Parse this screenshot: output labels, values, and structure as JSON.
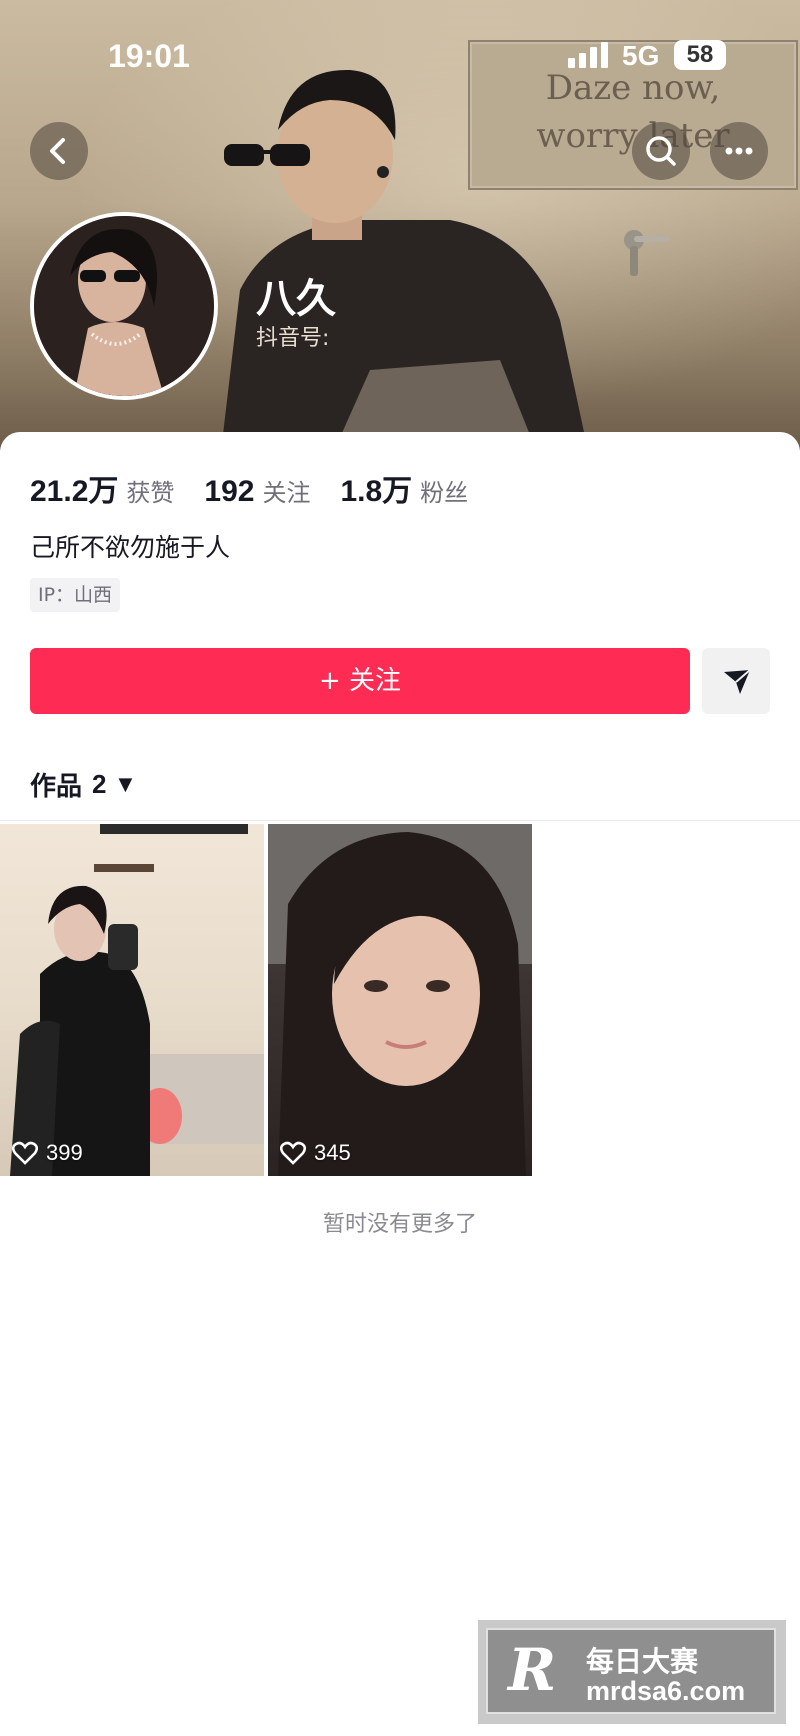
{
  "status_bar": {
    "time": "19:01",
    "network": "5G",
    "battery": "58"
  },
  "cover": {
    "sign_line1": "Daze now,",
    "sign_line2": "worry later"
  },
  "profile": {
    "name": "八久",
    "douyin_id_label": "抖音号:",
    "stats": [
      {
        "value": "21.2万",
        "label": "获赞"
      },
      {
        "value": "192",
        "label": "关注"
      },
      {
        "value": "1.8万",
        "label": "粉丝"
      }
    ],
    "bio": "己所不欲勿施于人",
    "ip": "IP：山西"
  },
  "actions": {
    "follow_label": "+ 关注"
  },
  "works": {
    "tab_label": "作品",
    "count": "2",
    "dropdown_glyph": "▼"
  },
  "videos": [
    {
      "likes": "399"
    },
    {
      "likes": "345"
    }
  ],
  "footer_text": "暂时没有更多了",
  "watermark": {
    "logo": "R",
    "title": "每日大赛",
    "url": "mrdsa6.com"
  },
  "colors": {
    "accent": "#fe2c55",
    "text": "#161823",
    "secondary": "#6f7079"
  }
}
